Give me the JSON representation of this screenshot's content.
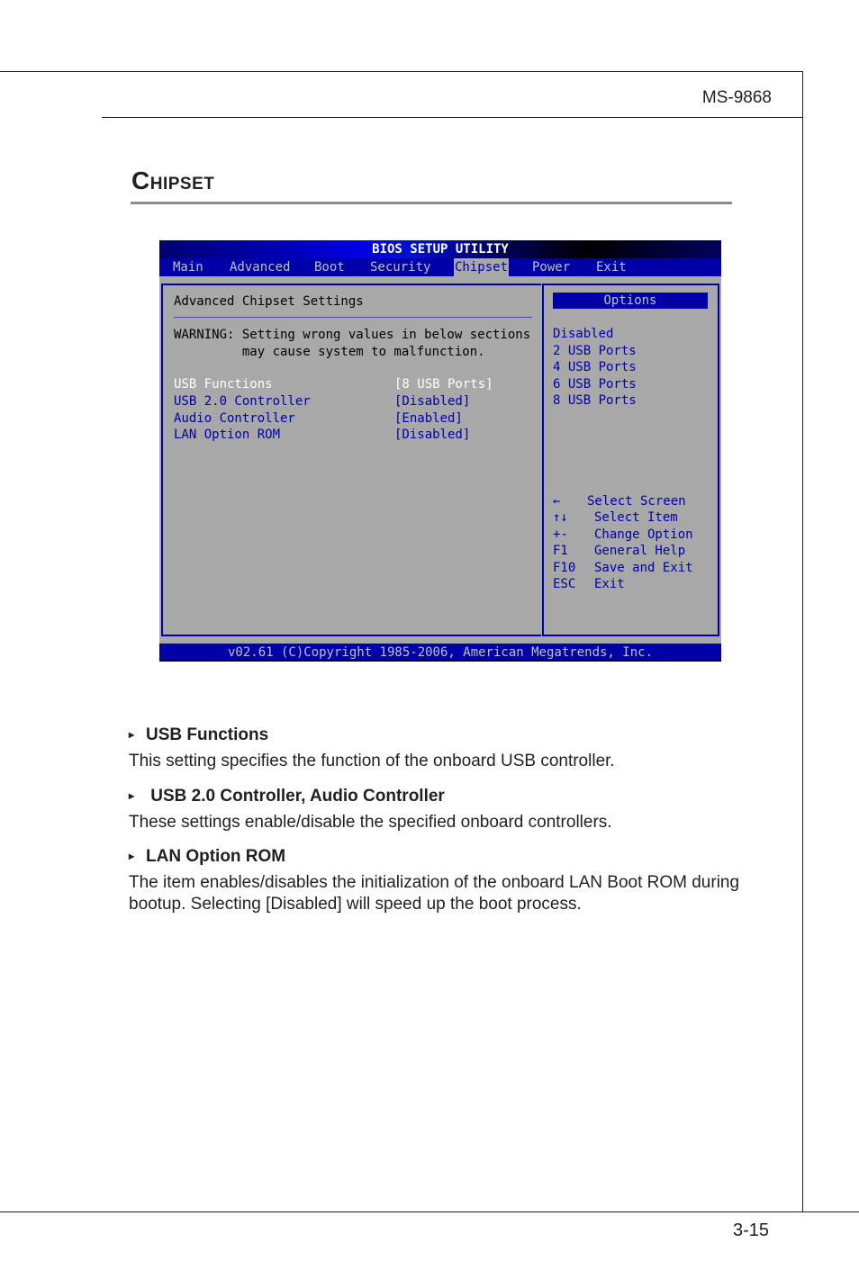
{
  "page": {
    "model": "MS-9868",
    "section_title_first": "C",
    "section_title_rest": "HIPSET",
    "page_number": "3-15"
  },
  "bios": {
    "title": "BIOS SETUP UTILITY",
    "menu": [
      {
        "label": "Main",
        "active": false
      },
      {
        "label": "Advanced",
        "active": false
      },
      {
        "label": "Boot",
        "active": false
      },
      {
        "label": "Security",
        "active": false
      },
      {
        "label": "Chipset",
        "active": true
      },
      {
        "label": "Power",
        "active": false
      },
      {
        "label": "Exit",
        "active": false
      }
    ],
    "main_panel": {
      "heading": "Advanced Chipset Settings",
      "warning": "WARNING: Setting wrong values in below sections\n         may cause system to malfunction.",
      "settings": [
        {
          "label": "USB Functions",
          "value": "[8 USB Ports]",
          "selected": true
        },
        {
          "label": "USB 2.0 Controller",
          "value": "[Disabled]",
          "selected": false
        },
        {
          "label": "Audio Controller",
          "value": "[Enabled]",
          "selected": false
        },
        {
          "label": "LAN Option ROM",
          "value": "[Disabled]",
          "selected": false
        }
      ]
    },
    "side_panel": {
      "options_title": "Options",
      "options": [
        "Disabled",
        "2 USB Ports",
        "4 USB Ports",
        "6 USB Ports",
        "8 USB Ports"
      ],
      "keys": [
        {
          "key": "←",
          "action": "Select Screen"
        },
        {
          "key": "↑↓",
          "action": "Select Item"
        },
        {
          "key": "+-",
          "action": "Change Option"
        },
        {
          "key": "F1",
          "action": "General Help"
        },
        {
          "key": "F10",
          "action": "Save and Exit"
        },
        {
          "key": "ESC",
          "action": "Exit"
        }
      ]
    },
    "footer": "v02.61 (C)Copyright 1985-2006, American Megatrends, Inc."
  },
  "descriptions": [
    {
      "title": "USB Functions",
      "body": "This setting specifies the function of the onboard USB controller."
    },
    {
      "title": " USB 2.0 Controller, Audio Controller",
      "body": "These settings enable/disable the specified onboard controllers."
    },
    {
      "title": "LAN Option ROM",
      "body": "The item enables/disables the initialization of the onboard LAN Boot ROM during bootup. Selecting [Disabled] will speed up the boot process."
    }
  ],
  "icons": {
    "bullet": "▸"
  }
}
